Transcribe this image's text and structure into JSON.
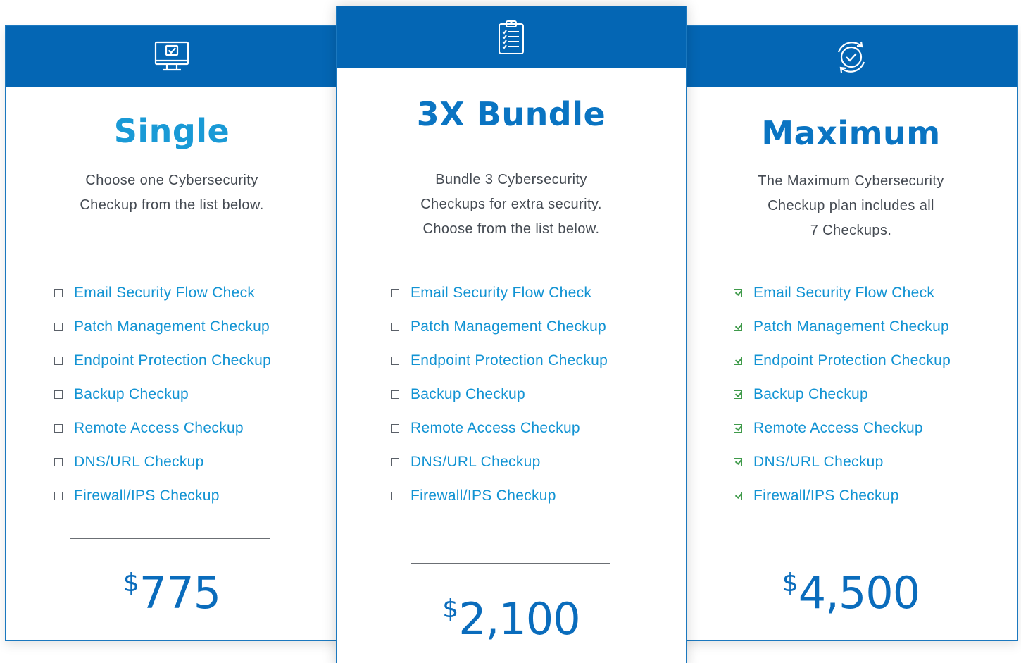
{
  "plans": [
    {
      "id": "single",
      "icon": "monitor-check-icon",
      "title": "Single",
      "description": [
        "Choose one Cybersecurity",
        "Checkup from the list below."
      ],
      "currency": "$",
      "price": "775",
      "features": [
        {
          "label": "Email Security Flow Check",
          "checked": false
        },
        {
          "label": "Patch Management Checkup",
          "checked": false
        },
        {
          "label": "Endpoint Protection Checkup",
          "checked": false
        },
        {
          "label": "Backup Checkup",
          "checked": false
        },
        {
          "label": "Remote Access Checkup",
          "checked": false
        },
        {
          "label": "DNS/URL Checkup",
          "checked": false
        },
        {
          "label": "Firewall/IPS Checkup",
          "checked": false
        }
      ]
    },
    {
      "id": "bundle",
      "icon": "clipboard-checklist-icon",
      "title": "3X Bundle",
      "description": [
        "Bundle 3 Cybersecurity",
        "Checkups for extra security.",
        "Choose from the list below."
      ],
      "currency": "$",
      "price": "2,100",
      "features": [
        {
          "label": "Email Security Flow Check",
          "checked": false
        },
        {
          "label": "Patch Management Checkup",
          "checked": false
        },
        {
          "label": "Endpoint Protection Checkup",
          "checked": false
        },
        {
          "label": "Backup Checkup",
          "checked": false
        },
        {
          "label": "Remote Access Checkup",
          "checked": false
        },
        {
          "label": "DNS/URL Checkup",
          "checked": false
        },
        {
          "label": "Firewall/IPS Checkup",
          "checked": false
        }
      ]
    },
    {
      "id": "maximum",
      "icon": "refresh-check-icon",
      "title": "Maximum",
      "description": [
        "The Maximum Cybersecurity",
        "Checkup plan includes all",
        "7 Checkups."
      ],
      "currency": "$",
      "price": "4,500",
      "features": [
        {
          "label": "Email Security Flow Check",
          "checked": true
        },
        {
          "label": "Patch Management Checkup",
          "checked": true
        },
        {
          "label": "Endpoint Protection Checkup",
          "checked": true
        },
        {
          "label": "Backup Checkup",
          "checked": true
        },
        {
          "label": "Remote Access Checkup",
          "checked": true
        },
        {
          "label": "DNS/URL Checkup",
          "checked": true
        },
        {
          "label": "Firewall/IPS Checkup",
          "checked": true
        }
      ]
    }
  ],
  "colors": {
    "header_band": "#0466b4",
    "title_single": "#1a9ad6",
    "title_other": "#0a74c2",
    "feature_text": "#1293d3",
    "price": "#0a6cbc",
    "check": "#3f9a4a"
  }
}
